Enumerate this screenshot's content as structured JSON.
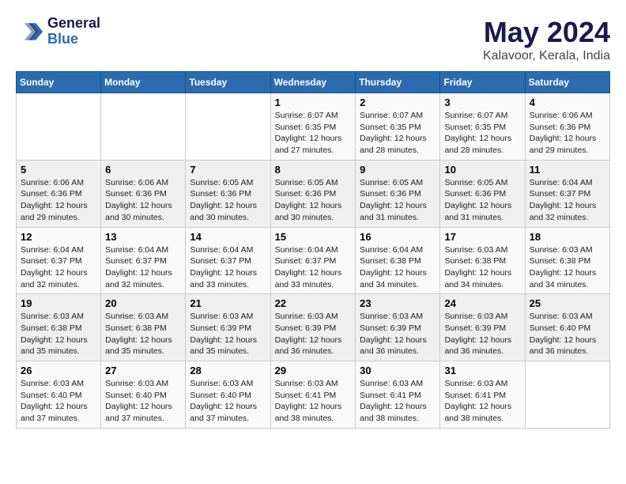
{
  "header": {
    "logo_line1": "General",
    "logo_line2": "Blue",
    "month": "May 2024",
    "location": "Kalavoor, Kerala, India"
  },
  "weekdays": [
    "Sunday",
    "Monday",
    "Tuesday",
    "Wednesday",
    "Thursday",
    "Friday",
    "Saturday"
  ],
  "weeks": [
    [
      {
        "day": "",
        "info": ""
      },
      {
        "day": "",
        "info": ""
      },
      {
        "day": "",
        "info": ""
      },
      {
        "day": "1",
        "info": "Sunrise: 6:07 AM\nSunset: 6:35 PM\nDaylight: 12 hours\nand 27 minutes."
      },
      {
        "day": "2",
        "info": "Sunrise: 6:07 AM\nSunset: 6:35 PM\nDaylight: 12 hours\nand 28 minutes."
      },
      {
        "day": "3",
        "info": "Sunrise: 6:07 AM\nSunset: 6:35 PM\nDaylight: 12 hours\nand 28 minutes."
      },
      {
        "day": "4",
        "info": "Sunrise: 6:06 AM\nSunset: 6:36 PM\nDaylight: 12 hours\nand 29 minutes."
      }
    ],
    [
      {
        "day": "5",
        "info": "Sunrise: 6:06 AM\nSunset: 6:36 PM\nDaylight: 12 hours\nand 29 minutes."
      },
      {
        "day": "6",
        "info": "Sunrise: 6:06 AM\nSunset: 6:36 PM\nDaylight: 12 hours\nand 30 minutes."
      },
      {
        "day": "7",
        "info": "Sunrise: 6:05 AM\nSunset: 6:36 PM\nDaylight: 12 hours\nand 30 minutes."
      },
      {
        "day": "8",
        "info": "Sunrise: 6:05 AM\nSunset: 6:36 PM\nDaylight: 12 hours\nand 30 minutes."
      },
      {
        "day": "9",
        "info": "Sunrise: 6:05 AM\nSunset: 6:36 PM\nDaylight: 12 hours\nand 31 minutes."
      },
      {
        "day": "10",
        "info": "Sunrise: 6:05 AM\nSunset: 6:36 PM\nDaylight: 12 hours\nand 31 minutes."
      },
      {
        "day": "11",
        "info": "Sunrise: 6:04 AM\nSunset: 6:37 PM\nDaylight: 12 hours\nand 32 minutes."
      }
    ],
    [
      {
        "day": "12",
        "info": "Sunrise: 6:04 AM\nSunset: 6:37 PM\nDaylight: 12 hours\nand 32 minutes."
      },
      {
        "day": "13",
        "info": "Sunrise: 6:04 AM\nSunset: 6:37 PM\nDaylight: 12 hours\nand 32 minutes."
      },
      {
        "day": "14",
        "info": "Sunrise: 6:04 AM\nSunset: 6:37 PM\nDaylight: 12 hours\nand 33 minutes."
      },
      {
        "day": "15",
        "info": "Sunrise: 6:04 AM\nSunset: 6:37 PM\nDaylight: 12 hours\nand 33 minutes."
      },
      {
        "day": "16",
        "info": "Sunrise: 6:04 AM\nSunset: 6:38 PM\nDaylight: 12 hours\nand 34 minutes."
      },
      {
        "day": "17",
        "info": "Sunrise: 6:03 AM\nSunset: 6:38 PM\nDaylight: 12 hours\nand 34 minutes."
      },
      {
        "day": "18",
        "info": "Sunrise: 6:03 AM\nSunset: 6:38 PM\nDaylight: 12 hours\nand 34 minutes."
      }
    ],
    [
      {
        "day": "19",
        "info": "Sunrise: 6:03 AM\nSunset: 6:38 PM\nDaylight: 12 hours\nand 35 minutes."
      },
      {
        "day": "20",
        "info": "Sunrise: 6:03 AM\nSunset: 6:38 PM\nDaylight: 12 hours\nand 35 minutes."
      },
      {
        "day": "21",
        "info": "Sunrise: 6:03 AM\nSunset: 6:39 PM\nDaylight: 12 hours\nand 35 minutes."
      },
      {
        "day": "22",
        "info": "Sunrise: 6:03 AM\nSunset: 6:39 PM\nDaylight: 12 hours\nand 36 minutes."
      },
      {
        "day": "23",
        "info": "Sunrise: 6:03 AM\nSunset: 6:39 PM\nDaylight: 12 hours\nand 36 minutes."
      },
      {
        "day": "24",
        "info": "Sunrise: 6:03 AM\nSunset: 6:39 PM\nDaylight: 12 hours\nand 36 minutes."
      },
      {
        "day": "25",
        "info": "Sunrise: 6:03 AM\nSunset: 6:40 PM\nDaylight: 12 hours\nand 36 minutes."
      }
    ],
    [
      {
        "day": "26",
        "info": "Sunrise: 6:03 AM\nSunset: 6:40 PM\nDaylight: 12 hours\nand 37 minutes."
      },
      {
        "day": "27",
        "info": "Sunrise: 6:03 AM\nSunset: 6:40 PM\nDaylight: 12 hours\nand 37 minutes."
      },
      {
        "day": "28",
        "info": "Sunrise: 6:03 AM\nSunset: 6:40 PM\nDaylight: 12 hours\nand 37 minutes."
      },
      {
        "day": "29",
        "info": "Sunrise: 6:03 AM\nSunset: 6:41 PM\nDaylight: 12 hours\nand 38 minutes."
      },
      {
        "day": "30",
        "info": "Sunrise: 6:03 AM\nSunset: 6:41 PM\nDaylight: 12 hours\nand 38 minutes."
      },
      {
        "day": "31",
        "info": "Sunrise: 6:03 AM\nSunset: 6:41 PM\nDaylight: 12 hours\nand 38 minutes."
      },
      {
        "day": "",
        "info": ""
      }
    ]
  ]
}
